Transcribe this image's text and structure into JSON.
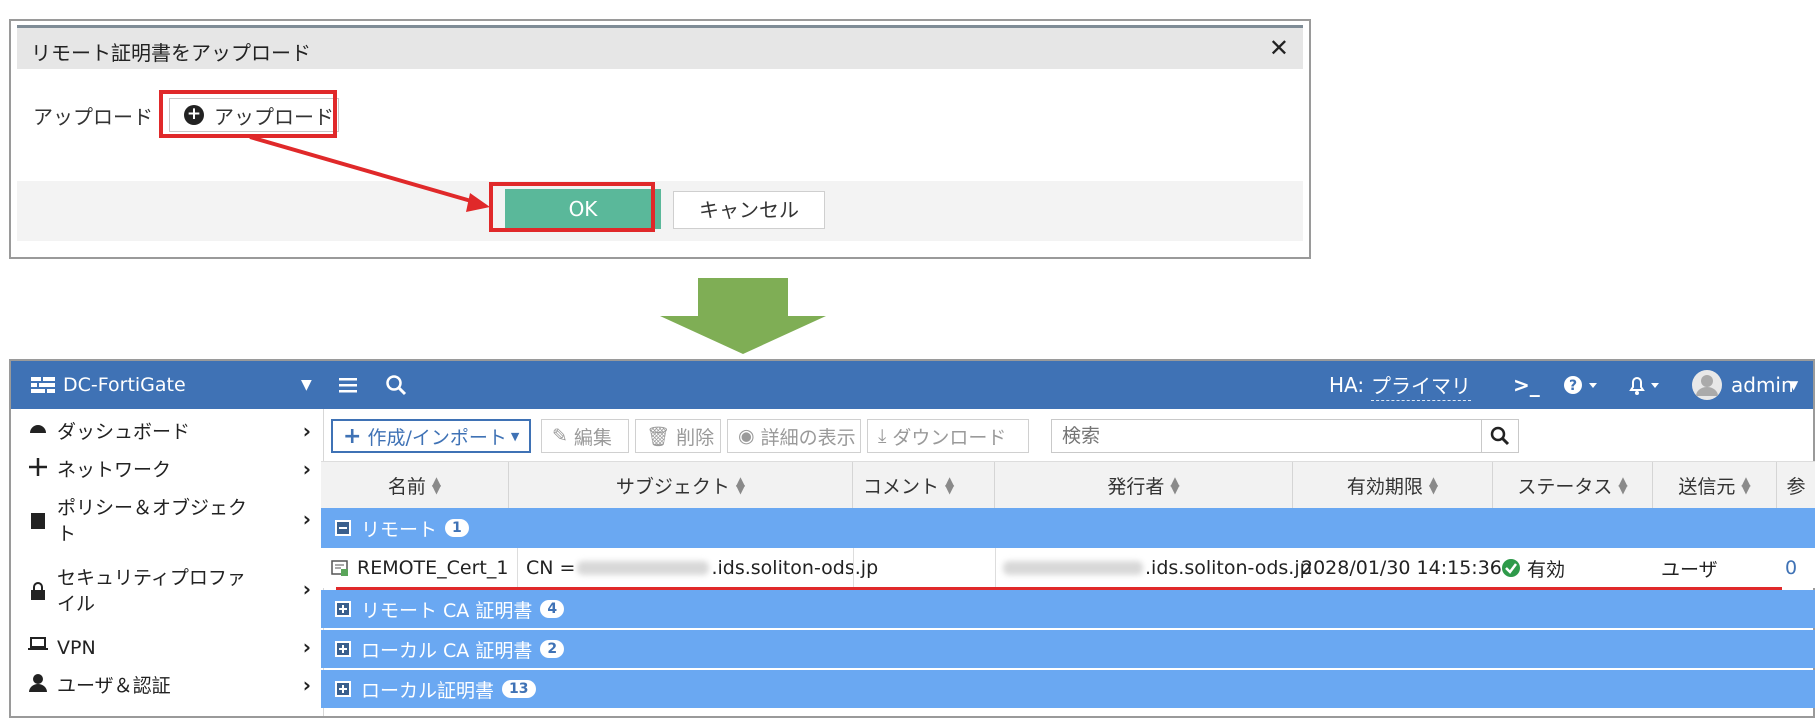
{
  "upload_dialog": {
    "title": "リモート証明書をアップロード",
    "close": "✕",
    "field_label": "アップロード",
    "upload_button": "アップロード",
    "ok_button": "OK",
    "cancel_button": "キャンセル"
  },
  "fortigate": {
    "device_name": "DC-FortiGate",
    "ha_label": "HA:",
    "ha_value": "プライマリ",
    "user": "admin",
    "sidebar": [
      {
        "label": "ダッシュボード",
        "icon": "dashboard-icon"
      },
      {
        "label": "ネットワーク",
        "icon": "network-icon"
      },
      {
        "label1": "ポリシー＆オブジェク",
        "label2": "ト",
        "icon": "policy-icon"
      },
      {
        "label1": "セキュリティプロファ",
        "label2": "イル",
        "icon": "lock-icon"
      },
      {
        "label": "VPN",
        "icon": "laptop-icon"
      },
      {
        "label": "ユーザ＆認証",
        "icon": "user-icon"
      }
    ],
    "toolbar": {
      "create": "作成/インポート",
      "edit": "編集",
      "delete": "削除",
      "details": "詳細の表示",
      "download": "ダウンロード",
      "search_placeholder": "検索"
    },
    "columns": [
      "名前",
      "サブジェクト",
      "コメント",
      "発行者",
      "有効期限",
      "ステータス",
      "送信元",
      "参"
    ],
    "groups": [
      {
        "label": "リモート",
        "count": "1"
      },
      {
        "label": "リモート CA 証明書",
        "count": "4"
      },
      {
        "label": "ローカル CA 証明書",
        "count": "2"
      },
      {
        "label": "ローカル証明書",
        "count": "13"
      }
    ],
    "row": {
      "name": "REMOTE_Cert_1",
      "subject_prefix": "CN =",
      "subject_suffix": ".ids.soliton-ods.jp",
      "issuer_suffix": ".ids.soliton-ods.jp",
      "expires": "2028/01/30 14:15:36",
      "status": "有効",
      "source": "ユーザ",
      "ref": "0"
    }
  },
  "colors": {
    "topbar": "#3f72b5",
    "group_row": "#6aa8f2",
    "ok_button": "#5ab89a",
    "highlight": "#e0292a",
    "arrow": "#7fae55"
  }
}
